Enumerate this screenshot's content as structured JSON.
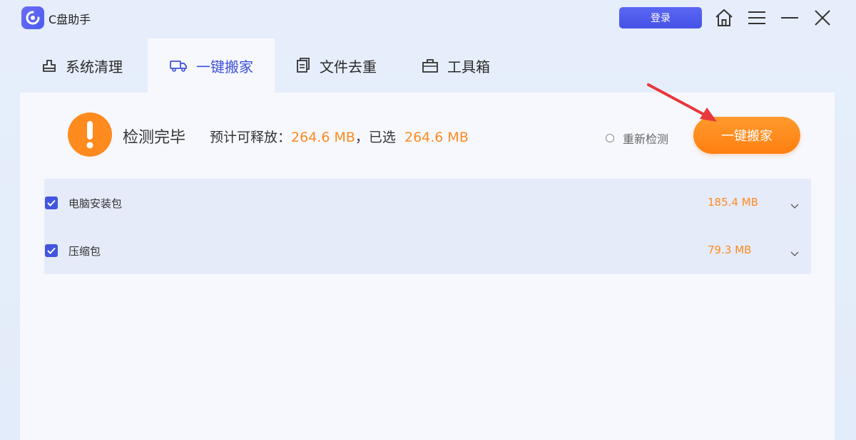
{
  "app": {
    "title": "C盘助手",
    "login_label": "登录"
  },
  "tabs": [
    {
      "label": "系统清理",
      "icon": "broom-icon"
    },
    {
      "label": "一键搬家",
      "icon": "truck-icon",
      "active": true
    },
    {
      "label": "文件去重",
      "icon": "duplicate-file-icon"
    },
    {
      "label": "工具箱",
      "icon": "toolbox-icon"
    }
  ],
  "status": {
    "title": "检测完毕",
    "prefix": "预计可释放：",
    "releasable": "264.6 MB",
    "middle": "，已选",
    "selected": "264.6 MB",
    "recheck_label": "重新检测",
    "action_label": "一键搬家"
  },
  "items": [
    {
      "name": "电脑安装包",
      "size": "185.4 MB",
      "checked": true
    },
    {
      "name": "压缩包",
      "size": "79.3 MB",
      "checked": true
    }
  ],
  "colors": {
    "accent": "#4356de",
    "orange": "#ff8a1e",
    "arrow": "#e8373d"
  }
}
